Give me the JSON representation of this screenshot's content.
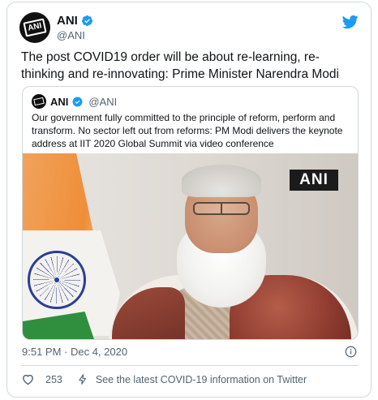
{
  "author": {
    "display_name": "ANI",
    "handle": "@ANI",
    "avatar_text": "ANI"
  },
  "tweet": {
    "text": "The post COVID19 order will be about re-learning, re-thinking and re-innovating: Prime Minister Narendra Modi",
    "timestamp": "9:51 PM · Dec 4, 2020"
  },
  "quoted": {
    "display_name": "ANI",
    "handle": "@ANI",
    "text": "Our government fully committed to the principle of reform, perform and transform. No sector left out from reforms: PM Modi delivers the keynote address at IIT 2020 Global Summit via video conference",
    "media_watermark": "ANI"
  },
  "actions": {
    "likes": "253",
    "covid_info": "See the latest COVID-19 information on Twitter"
  },
  "colors": {
    "twitter_blue": "#1d9bf0",
    "muted_text": "#536471",
    "border": "#cfd9de"
  }
}
